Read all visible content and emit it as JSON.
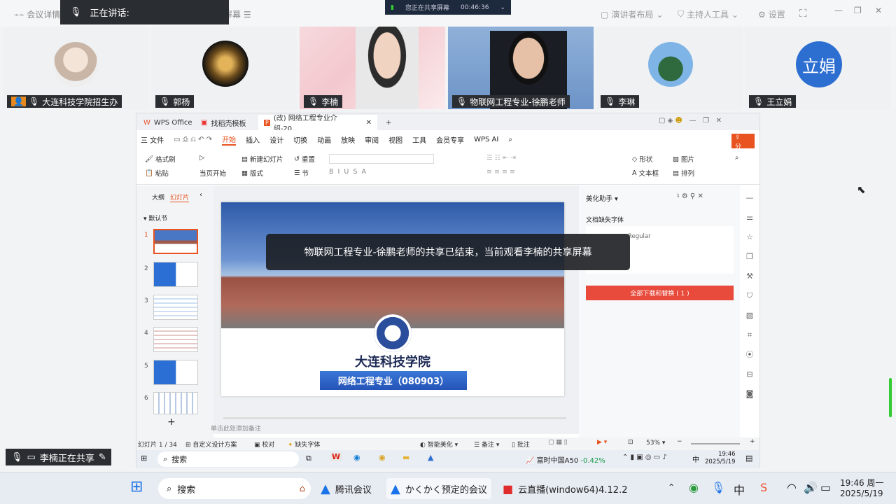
{
  "meeting": {
    "topbar_left": "会议详情",
    "topbar_share": "共享屏幕",
    "speaking_label": "正在讲话:",
    "share_badge_text": "您正在共享屏幕",
    "share_timer": "00:46:36",
    "presenter_layout": "演讲者布局",
    "host_tools": "主持人工具",
    "settings": "设置"
  },
  "participants": [
    {
      "name": "大连科技学院招生办"
    },
    {
      "name": "郭杨"
    },
    {
      "name": "李楠"
    },
    {
      "name": "物联网工程专业-徐鹏老师"
    },
    {
      "name": "李琳"
    },
    {
      "name": "王立娟",
      "avatar_text": "立娟"
    }
  ],
  "wps": {
    "tab_wps": "WPS Office",
    "tab_template": "找稻壳模板",
    "tab_doc": "(改) 网络工程专业介绍-20...",
    "menu": [
      "三 文件",
      "开始",
      "插入",
      "设计",
      "切换",
      "动画",
      "放映",
      "审阅",
      "视图",
      "工具",
      "会员专享",
      "WPS AI"
    ],
    "share_btn": "分享",
    "ribbon": {
      "format_painter": "格式刷",
      "paste": "粘贴",
      "play_from": "当页开始",
      "new_slide": "新建幻灯片",
      "layout": "版式",
      "reset": "重置",
      "section": "节",
      "shape": "形状",
      "picture": "图片",
      "textbox": "文本框",
      "arrange": "排列"
    },
    "panel_tabs": [
      "大纲",
      "幻灯片"
    ],
    "default_section": "默认节",
    "slide_numbers": [
      "1",
      "2",
      "3",
      "4",
      "5",
      "6"
    ],
    "slide_title_cn": "大连科技学院",
    "slide_subtitle": "网络工程专业（080903）",
    "notes_placeholder": "单击此处添加备注",
    "assistant_title": "美化助手",
    "missing_fonts": "文档缺失字体",
    "font_line": "Regular",
    "download_btn": "全部下载和替换 ( 1 )",
    "status_slide": "幻灯片 1 / 34",
    "status_custom": "自定义设计方案",
    "status_proof": "校对",
    "status_missing": "缺失字体",
    "status_beautify": "智能美化",
    "status_notes": "备注",
    "status_comments": "批注",
    "zoom": "53%",
    "inner_search": "搜索",
    "stock_name": "富时中国A50",
    "stock_change": "-0.42%",
    "ime": "中",
    "inner_time": "19:46",
    "inner_date": "2025/5/19"
  },
  "overlay_message": "物联网工程专业-徐鹏老师的共享已结束，当前观看李楠的共享屏幕",
  "sharing_status": "李楠正在共享",
  "taskbar": {
    "search": "搜索",
    "app1": "腾讯会议",
    "app2": "かくかく预定的会议",
    "app3": "云直播(window64)4.12.2",
    "ime": "中",
    "time": "19:46 周一",
    "date": "2025/5/19"
  },
  "colors": {
    "accent_orange": "#e8531f",
    "download_red": "#e84b3c",
    "blue_avatar": "#2c6fd1"
  }
}
